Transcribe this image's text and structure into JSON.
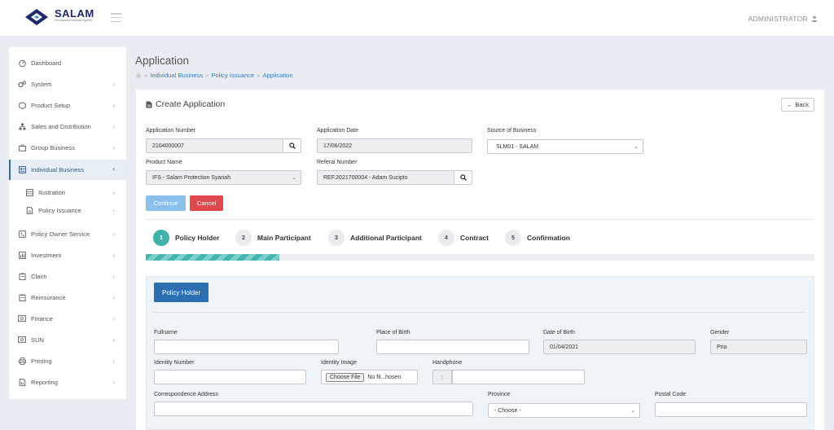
{
  "header": {
    "logo_title": "SALAM",
    "logo_tagline": "Perusahaan Asuransi Syariah",
    "user": "ADMINISTRATOR"
  },
  "sidebar": {
    "items": [
      {
        "label": "Dashboard",
        "icon": "dashboard-icon"
      },
      {
        "label": "System",
        "icon": "gears-icon"
      },
      {
        "label": "Product Setup",
        "icon": "box-icon"
      },
      {
        "label": "Sales and Distribution",
        "icon": "sitemap-icon"
      },
      {
        "label": "Group Business",
        "icon": "briefcase-icon"
      },
      {
        "label": "Individual Business",
        "icon": "user-card-icon"
      },
      {
        "label": "Ilustration",
        "icon": "table-icon"
      },
      {
        "label": "Policy Issuance",
        "icon": "file-icon"
      },
      {
        "label": "Policy Owner Service",
        "icon": "phone-icon"
      },
      {
        "label": "Investment",
        "icon": "bar-chart-icon"
      },
      {
        "label": "Claim",
        "icon": "clipboard-icon"
      },
      {
        "label": "Reinsurance",
        "icon": "clipboard-icon"
      },
      {
        "label": "Finance",
        "icon": "money-icon"
      },
      {
        "label": "SUN",
        "icon": "money-icon"
      },
      {
        "label": "Printing",
        "icon": "printer-icon"
      },
      {
        "label": "Reporting",
        "icon": "report-icon"
      }
    ]
  },
  "page": {
    "title": "Application",
    "breadcrumb": [
      "Individual Business",
      "Policy Issuance",
      "Application"
    ]
  },
  "card": {
    "title": "Create Application",
    "back_label": "Back"
  },
  "form": {
    "app_number_label": "Application Number",
    "app_number_value": "2104000007",
    "app_date_label": "Application Date",
    "app_date_value": "17/06/2022",
    "source_label": "Source of Business",
    "source_value": "SLM01 - SALAM",
    "product_label": "Product Name",
    "product_value": "IFS - Salam Protection Syariah",
    "referral_label": "Referal Number",
    "referral_value": "REF.2021700004 - Adam Sucipto",
    "continue_label": "Continue",
    "cancel_label": "Cancel"
  },
  "steps": [
    {
      "num": "1",
      "label": "Policy Holder"
    },
    {
      "num": "2",
      "label": "Main Participant"
    },
    {
      "num": "3",
      "label": "Additional Participant"
    },
    {
      "num": "4",
      "label": "Contract"
    },
    {
      "num": "5",
      "label": "Confirmation"
    }
  ],
  "progress": 0.2,
  "policy_holder": {
    "tab_label": "Policy Holder",
    "fullname_label": "Fullname",
    "pob_label": "Place of Birth",
    "dob_label": "Date of Birth",
    "dob_value": "01/04/2021",
    "gender_label": "Gender",
    "gender_value": "Pria",
    "identity_number_label": "Identity Number",
    "identity_image_label": "Identity Image",
    "choose_file_label": "Choose File",
    "file_status": "No fil...hosen",
    "handphone_label": "Handphone",
    "address_label": "Correspondence Address",
    "province_label": "Province",
    "province_value": "- Choose -",
    "postal_label": "Postal Code"
  },
  "colors": {
    "brand_navy": "#1f2a6b",
    "primary": "#2c6fb0",
    "step_active": "#3fb3ab",
    "cancel": "#e0484f",
    "continue_disabled": "#8cc0ec",
    "link": "#3a7bc0"
  }
}
